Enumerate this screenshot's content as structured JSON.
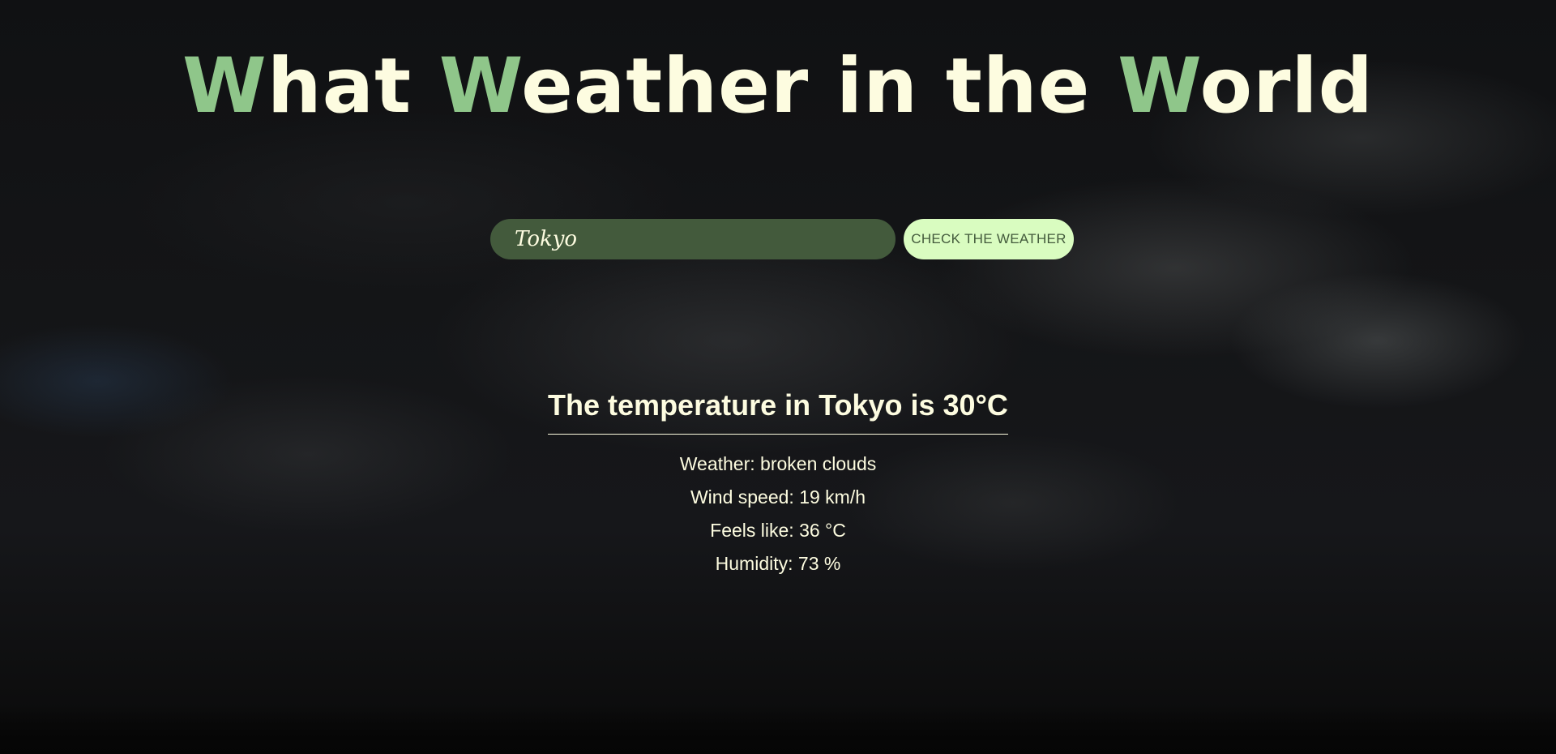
{
  "title": {
    "word1_initial": "W",
    "word1_rest": "hat ",
    "word2_initial": "W",
    "word2_rest": "eather in the ",
    "word3_initial": "W",
    "word3_rest": "orld"
  },
  "search": {
    "city_value": "Tokyo",
    "button_label": "CHECK THE WEATHER"
  },
  "result": {
    "heading": "The temperature in Tokyo is 30°C",
    "weather": "Weather: broken clouds",
    "wind_speed": "Wind speed: 19 km/h",
    "feels_like": "Feels like: 36 °C",
    "humidity": "Humidity: 73 %"
  },
  "colors": {
    "accent": "#8fc68a",
    "text": "#fdfce0",
    "input_bg": "#435a3c",
    "button_bg": "#d9fcc0"
  }
}
